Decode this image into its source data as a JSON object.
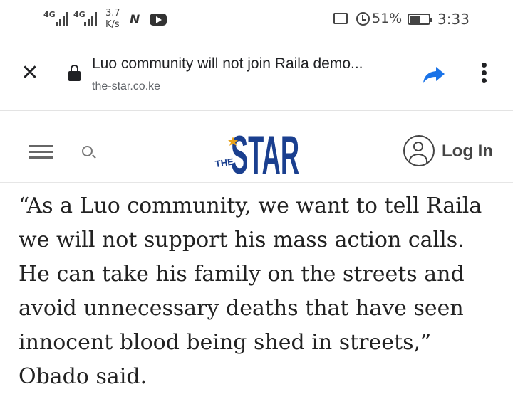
{
  "status_bar": {
    "net1": "4G",
    "net2": "4G",
    "speed_value": "3.7",
    "speed_unit": "K/s",
    "net_icon_label": "N",
    "battery": "51%",
    "time": "3:33",
    "icons": [
      "signal-icon",
      "signal-icon",
      "youtube-icon",
      "cast-icon",
      "alarm-icon",
      "battery-icon"
    ]
  },
  "toolbar": {
    "title": "Luo community will not join Raila demo...",
    "url": "the-star.co.ke",
    "icons": [
      "close-icon",
      "lock-icon",
      "share-icon",
      "more-vert-icon"
    ]
  },
  "site_header": {
    "logo_main": "STAR",
    "logo_small": "THE",
    "login": "Log In",
    "icons": [
      "hamburger-menu-icon",
      "search-icon",
      "user-icon"
    ],
    "brand_color": "#1a3f8f",
    "accent_color": "#e8a21b"
  },
  "article": {
    "paragraph": "“As a Luo community, we want to tell Raila we will not support his mass action calls. He can take his family on the streets and avoid unnecessary deaths that have seen innocent blood being shed in streets,” Obado said."
  }
}
